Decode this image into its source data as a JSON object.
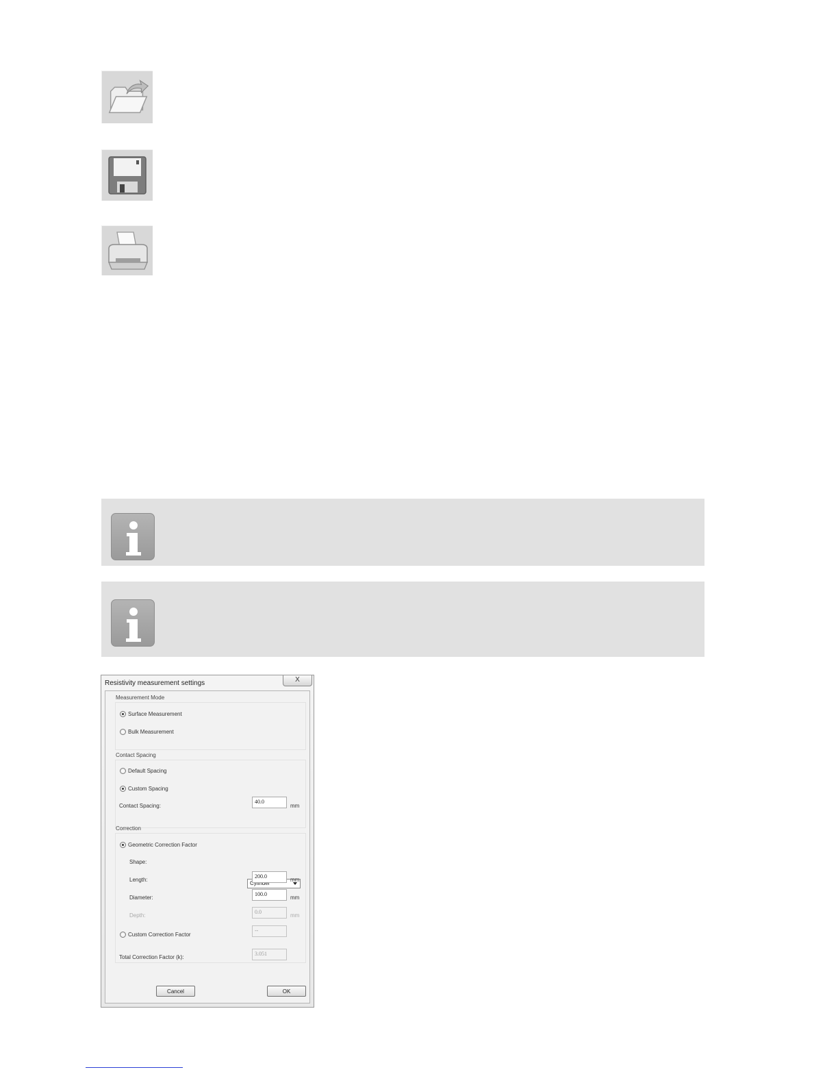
{
  "toolbar": {
    "icons": [
      "open-folder-icon",
      "save-floppy-icon",
      "printer-icon"
    ]
  },
  "notes": [
    {
      "icon": "info-icon"
    },
    {
      "icon": "info-icon"
    }
  ],
  "dialog": {
    "title": "Resistivity measurement settings",
    "close": "X",
    "measurement_mode": {
      "title": "Measurement Mode",
      "options": [
        "Surface Measurement",
        "Bulk Measurement"
      ],
      "selected": "Surface Measurement"
    },
    "contact_spacing": {
      "title": "Contact Spacing",
      "options": [
        "Default Spacing",
        "Custom Spacing"
      ],
      "selected": "Custom Spacing",
      "field_label": "Contact Spacing:",
      "value": "40.0",
      "unit": "mm"
    },
    "correction": {
      "title": "Correction",
      "geometric_label": "Geometric Correction Factor",
      "shape_label": "Shape:",
      "shape_value": "Cylinder",
      "length_label": "Length:",
      "length_value": "200.0",
      "diameter_label": "Diameter:",
      "diameter_value": "100.0",
      "depth_label": "Depth:",
      "depth_value": "0.0",
      "unit": "mm",
      "custom_label": "Custom Correction Factor",
      "custom_value": "--",
      "total_label": "Total Correction Factor (k):",
      "total_value": "3.051"
    },
    "cancel": "Cancel",
    "ok": "OK"
  }
}
